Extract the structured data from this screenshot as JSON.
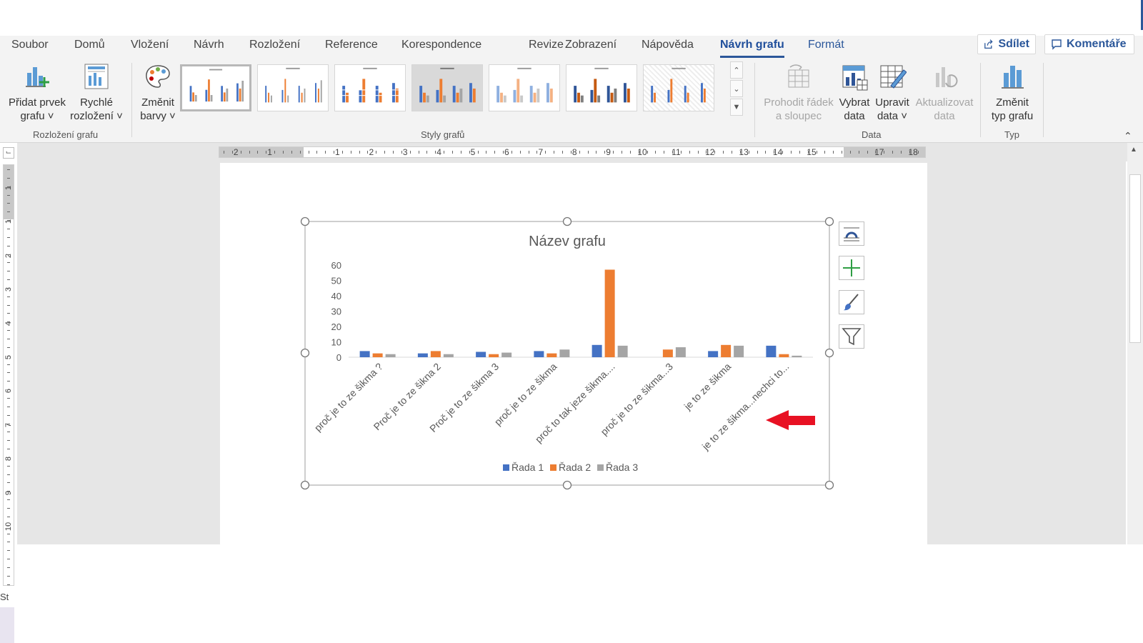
{
  "menu": {
    "tabs": [
      {
        "label": "Soubor"
      },
      {
        "label": "Domů"
      },
      {
        "label": "Vložení"
      },
      {
        "label": "Návrh"
      },
      {
        "label": "Rozložení"
      },
      {
        "label": "Reference"
      },
      {
        "label": "Korespondence"
      },
      {
        "label": "Revize"
      },
      {
        "label": "Zobrazení"
      },
      {
        "label": "Nápověda"
      },
      {
        "label": "Návrh grafu"
      },
      {
        "label": "Formát"
      }
    ],
    "active": "Návrh grafu",
    "share_label": "Sdílet",
    "comments_label": "Komentáře"
  },
  "ribbon": {
    "add_element": {
      "line1": "Přidat prvek",
      "line2": "grafu ˅"
    },
    "quick_layout": {
      "line1": "Rychlé",
      "line2": "rozložení ˅"
    },
    "change_colors": {
      "line1": "Změnit",
      "line2": "barvy ˅"
    },
    "switch_row_col": {
      "line1": "Prohodit řádek",
      "line2": "a sloupec"
    },
    "select_data": {
      "line1": "Vybrat",
      "line2": "data"
    },
    "edit_data": {
      "line1": "Upravit",
      "line2": "data ˅"
    },
    "refresh_data": {
      "line1": "Aktualizovat",
      "line2": "data"
    },
    "change_type": {
      "line1": "Změnit",
      "line2": "typ grafu"
    },
    "groups": {
      "layout": "Rozložení grafu",
      "styles": "Styly grafů",
      "data": "Data",
      "type": "Typ"
    }
  },
  "ruler": {
    "h_left": [
      "2",
      "1"
    ],
    "h_right": [
      "1",
      "2",
      "3",
      "4",
      "5",
      "6",
      "7",
      "8",
      "9",
      "10",
      "11",
      "12",
      "13",
      "14",
      "15",
      "17",
      "18"
    ],
    "v": [
      "1",
      "1",
      "2",
      "3",
      "4",
      "5",
      "6",
      "7",
      "8",
      "9",
      "10"
    ]
  },
  "status": {
    "left_text": "St"
  },
  "chart_data": {
    "type": "bar",
    "title": "Název grafu",
    "categories": [
      "proč je to ze šikma ?",
      "Proč je to ze šikna 2",
      "Proč je to ze šikma 3",
      "proč je to ze šikma",
      "proč to tak jeze šikma....",
      "proč je to ze šikma...3",
      "je to ze šikma",
      "je to ze šikma...nechci to..."
    ],
    "series": [
      {
        "name": "Řada 1",
        "color": "#4472c4",
        "values": [
          4,
          2.5,
          3.5,
          4,
          8,
          0,
          4,
          7.5
        ]
      },
      {
        "name": "Řada 2",
        "color": "#ed7d31",
        "values": [
          2.5,
          4,
          2,
          2.5,
          57,
          5,
          8,
          2
        ]
      },
      {
        "name": "Řada 3",
        "color": "#a5a5a5",
        "values": [
          2,
          2,
          3,
          5,
          7.5,
          6.5,
          7.5,
          1
        ]
      }
    ],
    "ylim": [
      0,
      60
    ],
    "yticks": [
      0,
      10,
      20,
      30,
      40,
      50,
      60
    ],
    "xlabel": "",
    "ylabel": "",
    "grid": false,
    "legend": "bottom"
  }
}
